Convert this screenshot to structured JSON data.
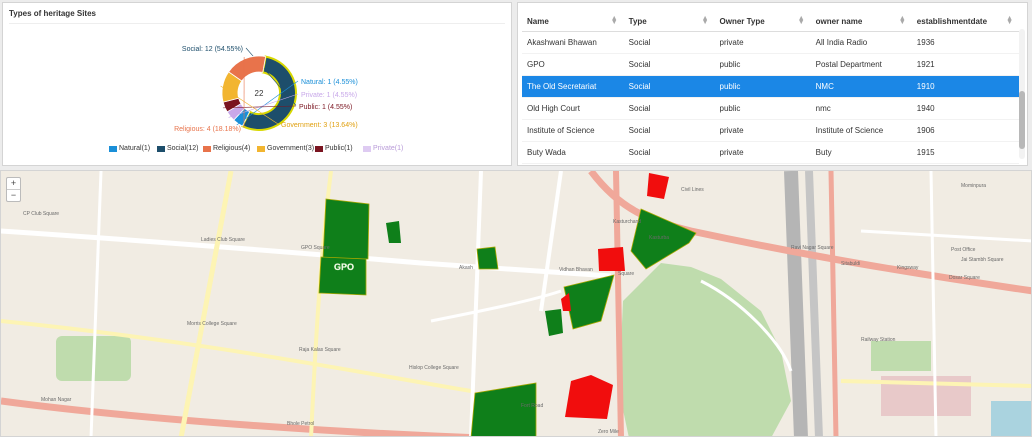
{
  "chart_data": {
    "type": "pie",
    "title": "Types of heritage Sites",
    "center_label": "22",
    "categories": [
      "Social",
      "Natural",
      "Private",
      "Public",
      "Government",
      "Religious"
    ],
    "values": [
      12,
      1,
      1,
      1,
      3,
      4
    ],
    "colors": [
      "#1d4e6b",
      "#1a8fd8",
      "#c8a8e9",
      "#7a1420",
      "#f2b530",
      "#e8734b"
    ],
    "slice_labels": [
      "Social: 12 (54.55%)",
      "Natural: 1 (4.55%)",
      "Private: 1 (4.55%)",
      "Public: 1 (4.55%)",
      "Government: 3 (13.64%)",
      "Religious: 4 (18.18%)"
    ],
    "legend": [
      {
        "label": "Natural(1)",
        "color": "#1a8fd8",
        "faded": false
      },
      {
        "label": "Social(12)",
        "color": "#1d4e6b",
        "faded": false
      },
      {
        "label": "Religious(4)",
        "color": "#e8734b",
        "faded": false
      },
      {
        "label": "Government(3)",
        "color": "#f2b530",
        "faded": false
      },
      {
        "label": "Public(1)",
        "color": "#7a1420",
        "faded": false
      },
      {
        "label": "Private(1)",
        "color": "#c8a8e9",
        "faded": true
      }
    ],
    "legend_position": "bottom"
  },
  "table": {
    "headers": [
      "Name",
      "Type",
      "Owner Type",
      "owner name",
      "establishmentdate"
    ],
    "rows": [
      [
        "Akashwani Bhawan",
        "Social",
        "private",
        "All India Radio",
        "1936"
      ],
      [
        "GPO",
        "Social",
        "public",
        "Postal Department",
        "1921"
      ],
      [
        "The Old Secretariat",
        "Social",
        "public",
        "NMC",
        "1910"
      ],
      [
        "Old High Court",
        "Social",
        "public",
        "nmc",
        "1940"
      ],
      [
        "Institute of Science",
        "Social",
        "private",
        "Institute of Science",
        "1906"
      ],
      [
        "Buty Wada",
        "Social",
        "private",
        "Buty",
        "1915"
      ]
    ],
    "selected_row": 2
  },
  "map": {
    "zoom_in": "+",
    "zoom_out": "−",
    "labels": [
      "CP Club Square",
      "Ladies Club Square",
      "GPO Square",
      "Akash",
      "Vidhan Bhavan",
      "Square",
      "Morris College Square",
      "Raja Kalas Square",
      "Hislop College Square",
      "Bhole Petrol",
      "Kasturchand",
      "Mominpura",
      "Jai Stambh Square",
      "Dosar Square",
      "Kingsway",
      "Ravi Nagar Square",
      "Sitabuldi",
      "Railway Station",
      "Civil Lines",
      "Zero Mile",
      "Post Office",
      "Kasturba",
      "Fort Road",
      "Mohan Nagar"
    ],
    "site_label": "GPO",
    "colors": {
      "green_site": "#0f7f1a",
      "red_site": "#f10d0d",
      "park": "#bfdcad",
      "rail": "#b5b5b5",
      "main_road": "#f0a89a",
      "road": "#fdf4b4"
    }
  }
}
